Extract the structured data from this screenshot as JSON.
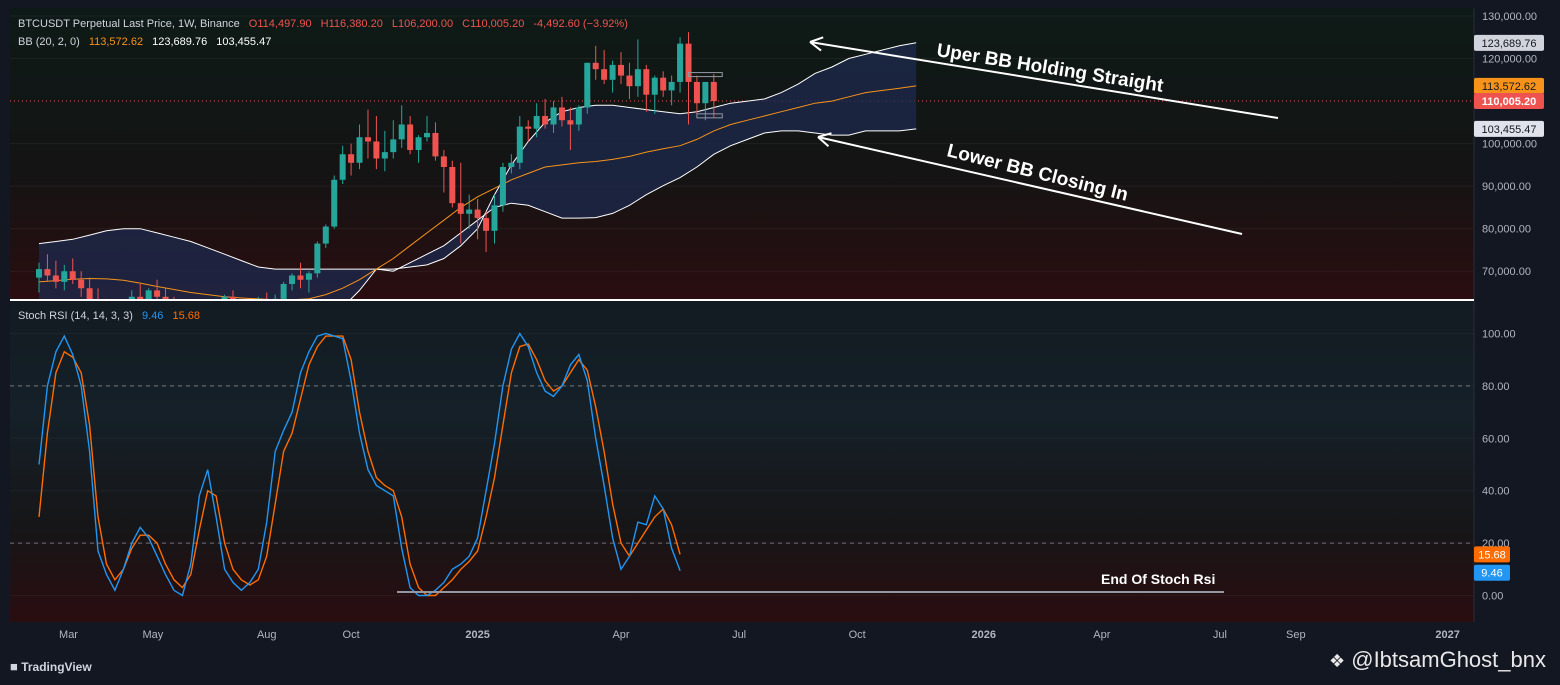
{
  "header": {
    "symbol_line": "BTCUSDT Perpetual Last Price, 1W, Binance",
    "open": "O114,497.90",
    "high": "H116,380.20",
    "low": "L106,200.00",
    "close": "C110,005.20",
    "change": "-4,492.60 (−3.92%)",
    "bb_label": "BB (20, 2, 0)",
    "bb_basis": "113,572.62",
    "bb_upper": "123,689.76",
    "bb_lower": "103,455.47",
    "stoch_label": "Stoch RSI (14, 14, 3, 3)",
    "stoch_k": "9.46",
    "stoch_d": "15.68"
  },
  "colors": {
    "background": "#131722",
    "up": "#26a69a",
    "down": "#ef5350",
    "bb_band": "#ffffff",
    "bb_basis": "#f7931a",
    "stoch_k": "#2196f3",
    "stoch_d": "#ff6d00",
    "cloud": "#1e2a4d"
  },
  "footer": {
    "brand": "TradingView",
    "watermark": "@IbtsamGhost_bnx"
  },
  "chart_data": [
    {
      "type": "candlestick",
      "title": "BTCUSDT Perpetual Last Price, 1W, Binance",
      "ylim": [
        65000,
        131000
      ],
      "y_ticks": [
        "130,000.00",
        "120,000.00",
        "100,000.00",
        "90,000.00",
        "80,000.00",
        "70,000.00"
      ],
      "y_tick_values": [
        130000,
        120000,
        100000,
        90000,
        80000,
        70000
      ],
      "price_labels": [
        {
          "text": "123,689.76",
          "value": 123689.76,
          "style": "upper"
        },
        {
          "text": "113,572.62",
          "value": 113572.62,
          "style": "basis"
        },
        {
          "text": "110,005.20",
          "value": 110005.2,
          "style": "last"
        },
        {
          "text": "103,455.47",
          "value": 103455.47,
          "style": "lower"
        }
      ],
      "last_price": 110005.2,
      "candles": [
        [
          68500,
          72000,
          65000,
          70500
        ],
        [
          70500,
          74000,
          67500,
          69000
        ],
        [
          69000,
          72500,
          66000,
          67500
        ],
        [
          67500,
          71500,
          65500,
          70000
        ],
        [
          70000,
          73000,
          67000,
          68000
        ],
        [
          68000,
          70000,
          64000,
          66000
        ],
        [
          66000,
          68500,
          62500,
          63000
        ],
        [
          63000,
          66000,
          60000,
          61500
        ],
        [
          61500,
          63500,
          58500,
          60000
        ],
        [
          60000,
          62500,
          57000,
          59500
        ],
        [
          59500,
          63000,
          58000,
          62500
        ],
        [
          62500,
          65500,
          61000,
          64000
        ],
        [
          64000,
          67000,
          62000,
          63000
        ],
        [
          63000,
          66000,
          61500,
          65500
        ],
        [
          65500,
          68000,
          63500,
          64000
        ],
        [
          64000,
          66000,
          61500,
          62500
        ],
        [
          62500,
          64000,
          59000,
          60000
        ],
        [
          60000,
          61500,
          56000,
          57500
        ],
        [
          57500,
          59000,
          53000,
          55000
        ],
        [
          55000,
          58000,
          49000,
          56500
        ],
        [
          56500,
          60000,
          55000,
          59000
        ],
        [
          59000,
          62000,
          57000,
          60500
        ],
        [
          60500,
          64500,
          59500,
          64000
        ],
        [
          64000,
          65500,
          58000,
          59000
        ],
        [
          59000,
          60500,
          56000,
          57000
        ],
        [
          57000,
          61000,
          56500,
          60500
        ],
        [
          60500,
          64000,
          59500,
          63000
        ],
        [
          63000,
          65000,
          61000,
          62000
        ],
        [
          62000,
          64500,
          60500,
          63500
        ],
        [
          63500,
          67500,
          62500,
          67000
        ],
        [
          67000,
          69500,
          65500,
          69000
        ],
        [
          69000,
          72000,
          66000,
          68000
        ],
        [
          68000,
          70000,
          65000,
          69500
        ],
        [
          69500,
          77000,
          68500,
          76500
        ],
        [
          76500,
          81000,
          75500,
          80500
        ],
        [
          80500,
          92500,
          80000,
          91500
        ],
        [
          91500,
          99500,
          90500,
          97500
        ],
        [
          97500,
          100000,
          92500,
          95500
        ],
        [
          95500,
          104500,
          94000,
          101500
        ],
        [
          101500,
          108000,
          96500,
          100500
        ],
        [
          100500,
          106500,
          94000,
          96500
        ],
        [
          96500,
          103000,
          93500,
          98000
        ],
        [
          98000,
          105500,
          96500,
          101000
        ],
        [
          101000,
          109000,
          99000,
          104500
        ],
        [
          104500,
          106500,
          97500,
          98500
        ],
        [
          98500,
          102000,
          95500,
          101500
        ],
        [
          101500,
          106500,
          100500,
          102500
        ],
        [
          102500,
          105000,
          96000,
          97000
        ],
        [
          97000,
          98500,
          88500,
          94500
        ],
        [
          94500,
          96000,
          85000,
          86000
        ],
        [
          86000,
          95500,
          76500,
          83500
        ],
        [
          83500,
          88000,
          80000,
          84500
        ],
        [
          84500,
          87000,
          77500,
          82500
        ],
        [
          82500,
          84000,
          74500,
          79500
        ],
        [
          79500,
          88000,
          76500,
          85500
        ],
        [
          85500,
          95500,
          84000,
          94500
        ],
        [
          94500,
          97500,
          93000,
          95500
        ],
        [
          95500,
          106500,
          94000,
          104000
        ],
        [
          104000,
          105500,
          100500,
          103500
        ],
        [
          103500,
          109500,
          101500,
          106500
        ],
        [
          106500,
          110500,
          103500,
          104500
        ],
        [
          104500,
          110000,
          102500,
          108500
        ],
        [
          108500,
          111000,
          104000,
          105500
        ],
        [
          105500,
          108500,
          98500,
          104500
        ],
        [
          104500,
          109000,
          103000,
          108500
        ],
        [
          108500,
          119000,
          107000,
          119000
        ],
        [
          119000,
          123000,
          115000,
          117500
        ],
        [
          117500,
          122000,
          114000,
          115000
        ],
        [
          115000,
          119500,
          112000,
          118500
        ],
        [
          118500,
          121500,
          114000,
          116000
        ],
        [
          116000,
          119000,
          110500,
          113500
        ],
        [
          113500,
          124500,
          111000,
          117500
        ],
        [
          117500,
          118500,
          107500,
          111500
        ],
        [
          111500,
          116000,
          107000,
          115500
        ],
        [
          115500,
          117000,
          111000,
          112500
        ],
        [
          112500,
          116000,
          109000,
          114500
        ],
        [
          114500,
          125000,
          112000,
          123500
        ],
        [
          123500,
          126200,
          104500,
          114500
        ],
        [
          114500,
          116000,
          107000,
          109500
        ],
        [
          109500,
          114000,
          105500,
          114500
        ],
        [
          114497.9,
          116380.2,
          106200,
          110005.2
        ]
      ],
      "bb_upper": [
        76500,
        77000,
        77500,
        78500,
        79500,
        80000,
        80000,
        79000,
        78000,
        77000,
        75500,
        74000,
        72500,
        71000,
        70500,
        70500,
        70500,
        70500,
        70500,
        70500,
        70500,
        70500,
        71000,
        71500,
        73000,
        76000,
        80000,
        88000,
        95000,
        100500,
        105000,
        107500,
        108500,
        109000,
        109000,
        108500,
        108000,
        107500,
        107000,
        107500,
        108500,
        109500,
        110000,
        110500,
        112000,
        114000,
        116500,
        118000,
        120000,
        121000,
        122000,
        123000,
        123700
      ],
      "bb_basis": [
        67500,
        67800,
        68100,
        68300,
        68200,
        67900,
        67200,
        66400,
        65700,
        65000,
        64500,
        64000,
        63700,
        63500,
        63300,
        63300,
        63500,
        64500,
        66000,
        68000,
        70500,
        73000,
        76000,
        79000,
        82000,
        85000,
        87500,
        89500,
        91500,
        93000,
        94500,
        95000,
        95500,
        95800,
        96300,
        97000,
        98000,
        98800,
        99500,
        101000,
        103000,
        104500,
        105500,
        106500,
        107500,
        108500,
        109500,
        110000,
        111000,
        112000,
        112500,
        113000,
        113572
      ],
      "bb_lower": [
        58500,
        58600,
        58700,
        58100,
        56900,
        55800,
        54400,
        53800,
        53400,
        53000,
        53500,
        54000,
        54900,
        56000,
        56100,
        56100,
        56500,
        58500,
        61500,
        65500,
        70500,
        70000,
        72000,
        74000,
        76000,
        79000,
        82000,
        85000,
        86000,
        85500,
        84000,
        82500,
        82500,
        82600,
        83600,
        85500,
        88000,
        90100,
        92000,
        94500,
        97500,
        99500,
        101000,
        102500,
        103000,
        103000,
        102500,
        102000,
        102000,
        103000,
        103000,
        103000,
        103455
      ],
      "annotations": [
        {
          "text": "Uper BB Holding Straight"
        },
        {
          "text": "Lower BB Closing In"
        }
      ]
    },
    {
      "type": "line",
      "title": "Stoch RSI (14, 14, 3, 3)",
      "ylim": [
        -10,
        105
      ],
      "y_ticks": [
        "100.00",
        "80.00",
        "60.00",
        "40.00",
        "20.00",
        "0.00"
      ],
      "y_tick_values": [
        100,
        80,
        60,
        40,
        20,
        0
      ],
      "levels": [
        80,
        20
      ],
      "x_ticks": [
        "Mar",
        "May",
        "Aug",
        "Oct",
        "2025",
        "Apr",
        "Jul",
        "Oct",
        "2026",
        "Apr",
        "Jul",
        "Sep",
        "2027"
      ],
      "x_tick_index": [
        3.5,
        13.5,
        27,
        37,
        52,
        69,
        83,
        97,
        112,
        126,
        140,
        149,
        167
      ],
      "series": [
        {
          "name": "K",
          "label": "9.46",
          "values": [
            50,
            80,
            93,
            99,
            92,
            80,
            55,
            17,
            8,
            2,
            10,
            20,
            26,
            22,
            15,
            8,
            2,
            0,
            12,
            38,
            48,
            30,
            10,
            5,
            2,
            5,
            10,
            28,
            55,
            63,
            70,
            85,
            93,
            99,
            100,
            99,
            98,
            82,
            62,
            48,
            42,
            40,
            38,
            18,
            3,
            0,
            0,
            2,
            5,
            10,
            12,
            15,
            22,
            40,
            58,
            80,
            94,
            100,
            95,
            85,
            78,
            76,
            80,
            88,
            92,
            82,
            60,
            42,
            22,
            10,
            15,
            28,
            27,
            38,
            33,
            18,
            9.46
          ]
        },
        {
          "name": "D",
          "label": "15.68",
          "values": [
            30,
            62,
            85,
            93,
            91,
            85,
            65,
            30,
            12,
            6,
            10,
            18,
            23,
            23,
            20,
            12,
            6,
            3,
            8,
            25,
            40,
            38,
            20,
            10,
            6,
            4,
            6,
            15,
            35,
            55,
            62,
            75,
            88,
            95,
            99,
            99,
            99,
            90,
            70,
            55,
            45,
            42,
            40,
            30,
            12,
            3,
            0,
            0,
            3,
            6,
            10,
            13,
            17,
            30,
            45,
            65,
            85,
            95,
            96,
            90,
            82,
            78,
            80,
            85,
            90,
            86,
            72,
            55,
            35,
            20,
            15,
            20,
            25,
            30,
            33,
            27,
            15.68
          ]
        }
      ],
      "annotations": [
        {
          "text": "End Of Stoch Rsi"
        }
      ]
    }
  ]
}
